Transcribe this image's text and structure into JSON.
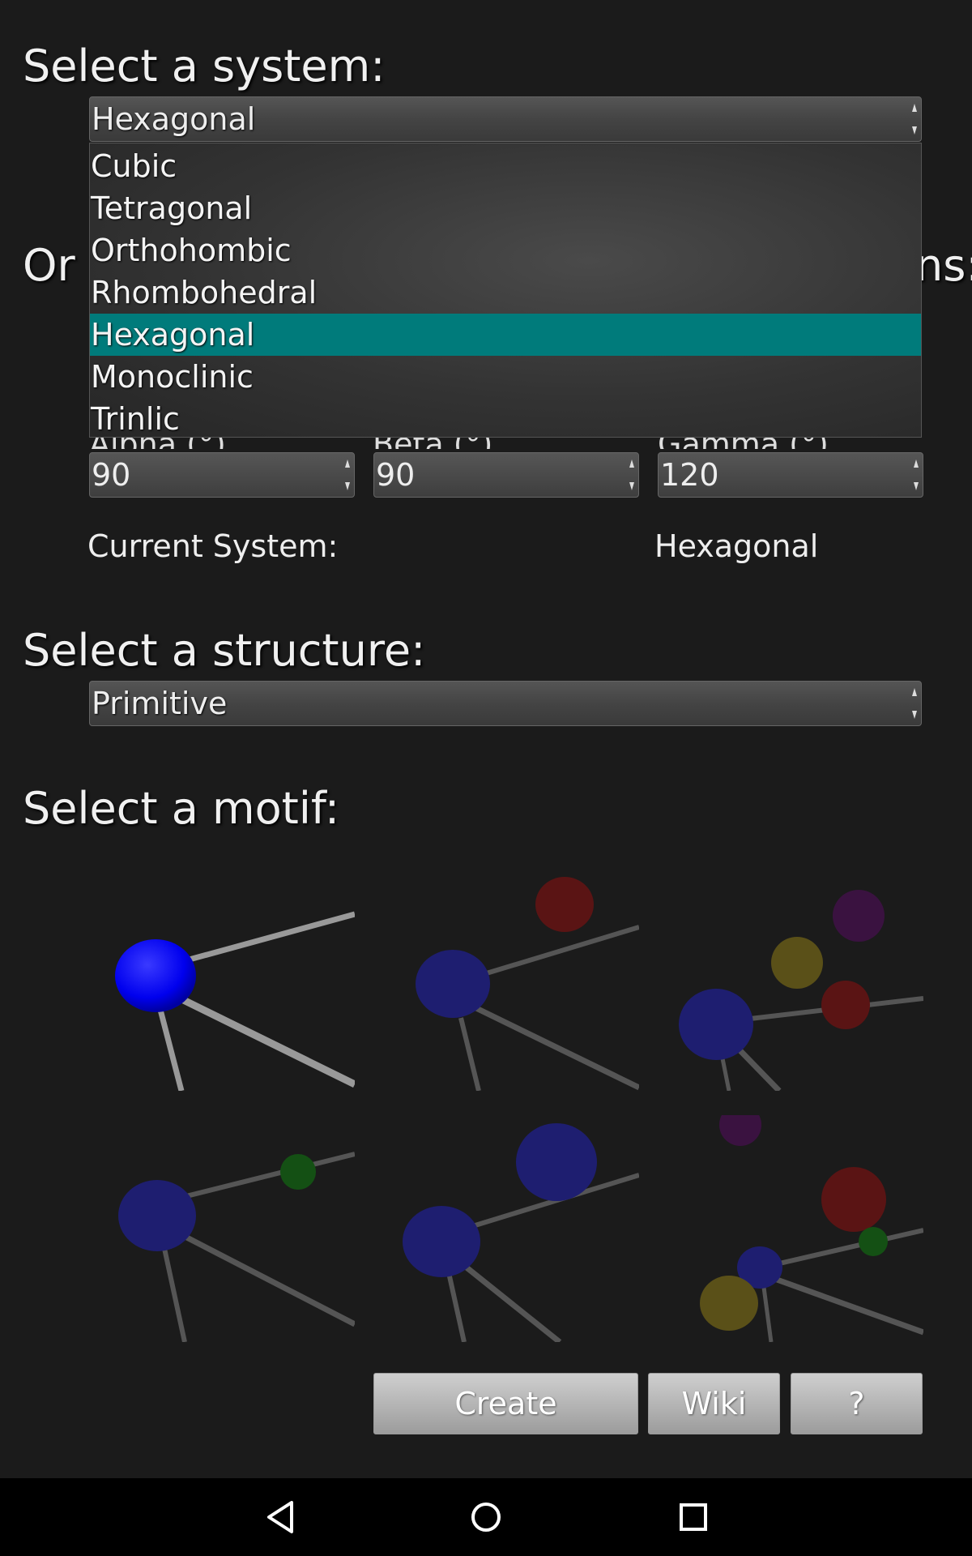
{
  "system": {
    "heading": "Select a system:",
    "selected": "Hexagonal",
    "options": [
      "Cubic",
      "Tetragonal",
      "Orthohombic",
      "Rhombohedral",
      "Hexagonal",
      "Monoclinic",
      "Trinlic"
    ],
    "selected_index": 4,
    "highlight_color": "#007b7b"
  },
  "dimensions": {
    "heading_left": "Or",
    "heading_right": "ns:",
    "labels": [
      "Alpha (°)",
      "Beta (°)",
      "Gamma (°)"
    ],
    "values": [
      "90",
      "90",
      "120"
    ]
  },
  "current_system": {
    "label": "Current System:",
    "value": "Hexagonal"
  },
  "structure": {
    "heading": "Select a structure:",
    "selected": "Primitive"
  },
  "motif": {
    "heading": "Select a motif:",
    "items": [
      {
        "name": "motif-1",
        "atoms": [
          "blue"
        ]
      },
      {
        "name": "motif-2",
        "atoms": [
          "blue",
          "red"
        ]
      },
      {
        "name": "motif-3",
        "atoms": [
          "blue",
          "red",
          "yellow",
          "purple"
        ]
      },
      {
        "name": "motif-4",
        "atoms": [
          "blue",
          "green"
        ]
      },
      {
        "name": "motif-5",
        "atoms": [
          "blue",
          "blue"
        ]
      },
      {
        "name": "motif-6",
        "atoms": [
          "blue",
          "red",
          "yellow",
          "green",
          "purple"
        ]
      }
    ]
  },
  "buttons": {
    "create": "Create",
    "wiki": "Wiki",
    "help": "?"
  },
  "nav": {
    "icons": [
      "back-icon",
      "home-icon",
      "recents-icon"
    ]
  }
}
